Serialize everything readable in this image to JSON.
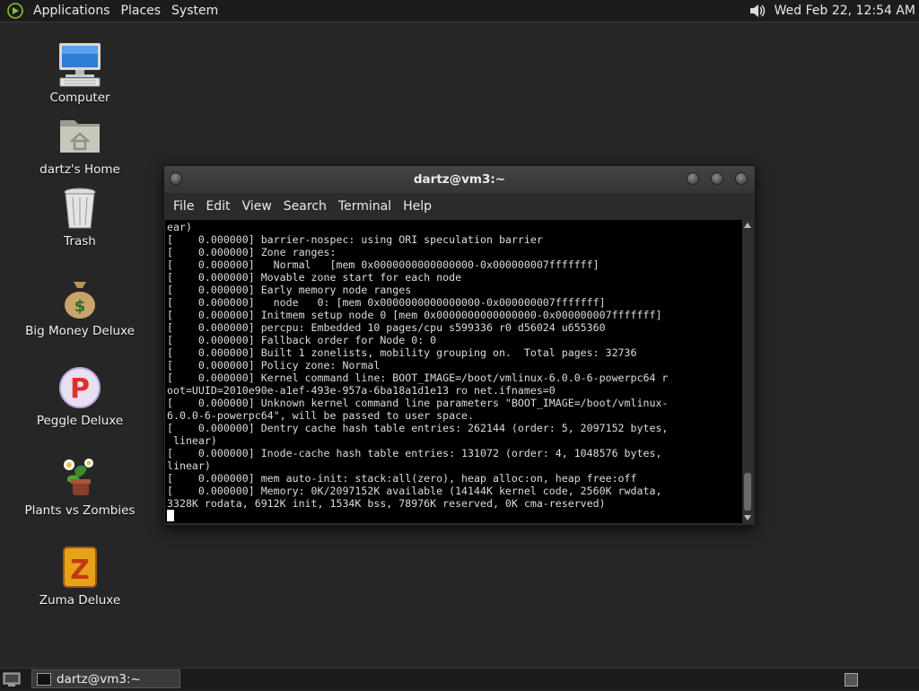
{
  "top_panel": {
    "menus": [
      "Applications",
      "Places",
      "System"
    ],
    "clock": "Wed Feb 22, 12:54 AM",
    "logo_icon": "gnome-foot-icon",
    "volume_icon": "speaker-icon"
  },
  "desktop": {
    "icons": [
      {
        "label": "Computer",
        "icon": "computer-icon"
      },
      {
        "label": "dartz's Home",
        "icon": "home-folder-icon"
      },
      {
        "label": "Trash",
        "icon": "trash-icon"
      },
      {
        "label": "Big Money Deluxe",
        "icon": "money-bag-icon"
      },
      {
        "label": "Peggle Deluxe",
        "icon": "peggle-icon"
      },
      {
        "label": "Plants vs Zombies",
        "icon": "plants-vs-zombies-icon"
      },
      {
        "label": "Zuma Deluxe",
        "icon": "zuma-icon"
      }
    ]
  },
  "terminal": {
    "title": "dartz@vm3:~",
    "menu": [
      "File",
      "Edit",
      "View",
      "Search",
      "Terminal",
      "Help"
    ],
    "lines": [
      "ear)",
      "[    0.000000] barrier-nospec: using ORI speculation barrier",
      "[    0.000000] Zone ranges:",
      "[    0.000000]   Normal   [mem 0x0000000000000000-0x000000007fffffff]",
      "[    0.000000] Movable zone start for each node",
      "[    0.000000] Early memory node ranges",
      "[    0.000000]   node   0: [mem 0x0000000000000000-0x000000007fffffff]",
      "[    0.000000] Initmem setup node 0 [mem 0x0000000000000000-0x000000007fffffff]",
      "[    0.000000] percpu: Embedded 10 pages/cpu s599336 r0 d56024 u655360",
      "[    0.000000] Fallback order for Node 0: 0",
      "[    0.000000] Built 1 zonelists, mobility grouping on.  Total pages: 32736",
      "[    0.000000] Policy zone: Normal",
      "[    0.000000] Kernel command line: BOOT_IMAGE=/boot/vmlinux-6.0.0-6-powerpc64 r",
      "oot=UUID=2010e90e-a1ef-493e-957a-6ba18a1d1e13 ro net.ifnames=0",
      "[    0.000000] Unknown kernel command line parameters \"BOOT_IMAGE=/boot/vmlinux-",
      "6.0.0-6-powerpc64\", will be passed to user space.",
      "[    0.000000] Dentry cache hash table entries: 262144 (order: 5, 2097152 bytes,",
      " linear)",
      "[    0.000000] Inode-cache hash table entries: 131072 (order: 4, 1048576 bytes,",
      "linear)",
      "[    0.000000] mem auto-init: stack:all(zero), heap alloc:on, heap free:off",
      "[    0.000000] Memory: 0K/2097152K available (14144K kernel code, 2560K rwdata,",
      "3328K rodata, 6912K init, 1534K bss, 78976K reserved, 0K cma-reserved)"
    ]
  },
  "bottom_panel": {
    "task_label": "dartz@vm3:~",
    "show_desktop_icon": "show-desktop-icon",
    "workspace_icon": "workspace-switcher-icon"
  }
}
